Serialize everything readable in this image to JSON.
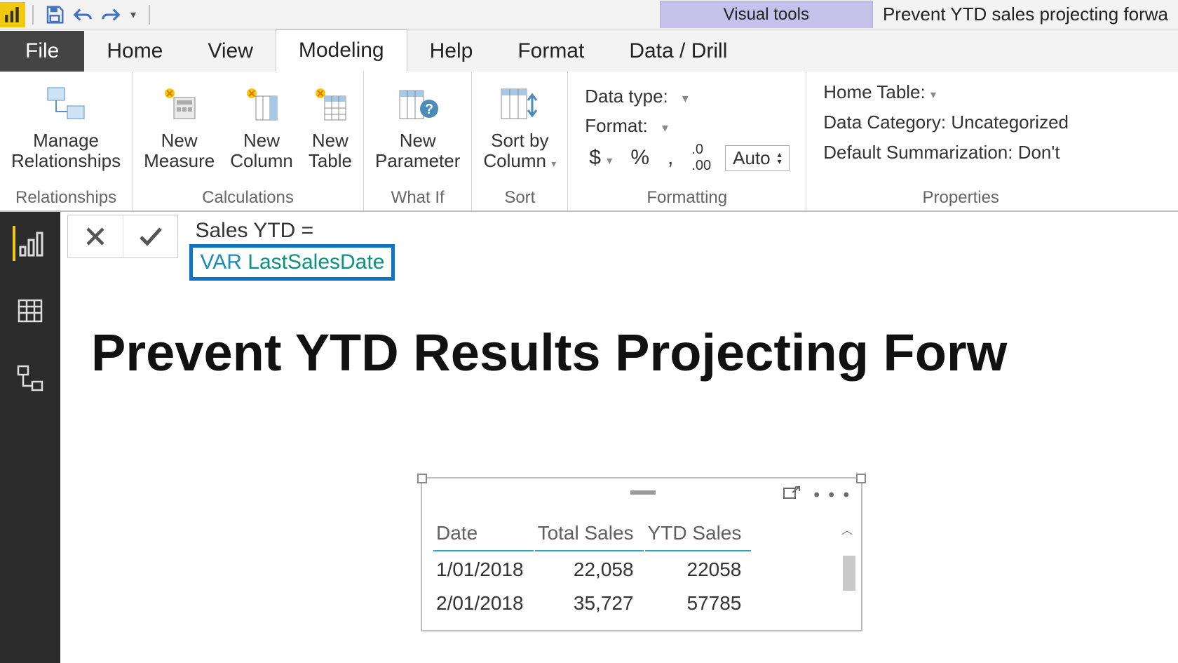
{
  "titlebar": {
    "visual_tools": "Visual tools",
    "doc_title": "Prevent YTD sales projecting forwa"
  },
  "tabs": {
    "file": "File",
    "home": "Home",
    "view": "View",
    "modeling": "Modeling",
    "help": "Help",
    "format": "Format",
    "data_drill": "Data / Drill"
  },
  "ribbon": {
    "relationships": {
      "manage": "Manage\nRelationships",
      "group": "Relationships"
    },
    "calculations": {
      "measure": "New\nMeasure",
      "column": "New\nColumn",
      "table": "New\nTable",
      "group": "Calculations"
    },
    "whatif": {
      "parameter": "New\nParameter",
      "group": "What If"
    },
    "sort": {
      "sortby": "Sort by\nColumn",
      "group": "Sort"
    },
    "formatting": {
      "data_type": "Data type:",
      "format": "Format:",
      "dollar": "$",
      "percent": "%",
      "comma": ",",
      "decimals": ".00",
      "auto": "Auto",
      "group": "Formatting"
    },
    "properties": {
      "home_table": "Home Table:",
      "data_category": "Data Category: Uncategorized",
      "default_summ": "Default Summarization: Don't",
      "group": "Properties"
    }
  },
  "formula": {
    "line1": "Sales YTD =",
    "var": "VAR",
    "name": "LastSalesDate"
  },
  "canvas": {
    "title": "Prevent YTD Results Projecting Forw"
  },
  "table": {
    "headers": [
      "Date",
      "Total Sales",
      "YTD Sales"
    ],
    "rows": [
      {
        "date": "1/01/2018",
        "total": "22,058",
        "ytd": "22058"
      },
      {
        "date": "2/01/2018",
        "total": "35,727",
        "ytd": "57785"
      }
    ]
  }
}
